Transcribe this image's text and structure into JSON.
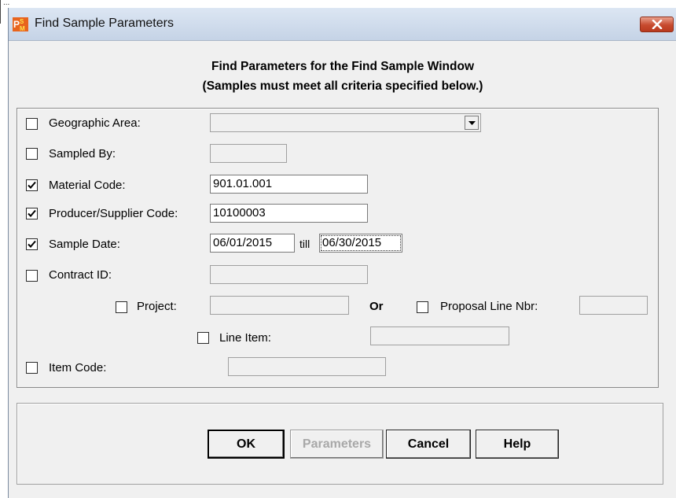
{
  "window": {
    "title": "Find Sample Parameters",
    "icon": "psm-app-icon"
  },
  "header": {
    "line1": "Find Parameters for the Find Sample Window",
    "line2": "(Samples must meet all criteria specified below.)"
  },
  "criteria": {
    "geographic_area": {
      "label": "Geographic Area:",
      "checked": false,
      "value": ""
    },
    "sampled_by": {
      "label": "Sampled By:",
      "checked": false,
      "value": ""
    },
    "material_code": {
      "label": "Material Code:",
      "checked": true,
      "value": "901.01.001"
    },
    "producer_supplier_code": {
      "label": "Producer/Supplier Code:",
      "checked": true,
      "value": "10100003"
    },
    "sample_date": {
      "label": "Sample Date:",
      "checked": true,
      "from": "06/01/2015",
      "till_label": "till",
      "to": "06/30/2015"
    },
    "contract_id": {
      "label": "Contract ID:",
      "checked": false,
      "value": ""
    },
    "project": {
      "label": "Project:",
      "checked": false,
      "value": ""
    },
    "or_label": "Or",
    "proposal_line_nbr": {
      "label": "Proposal Line Nbr:",
      "checked": false,
      "value": ""
    },
    "line_item": {
      "label": "Line Item:",
      "checked": false,
      "value": ""
    },
    "item_code": {
      "label": "Item Code:",
      "checked": false,
      "value": ""
    }
  },
  "buttons": {
    "ok": "OK",
    "parameters": "Parameters",
    "cancel": "Cancel",
    "help": "Help"
  },
  "background_fragment": "..."
}
